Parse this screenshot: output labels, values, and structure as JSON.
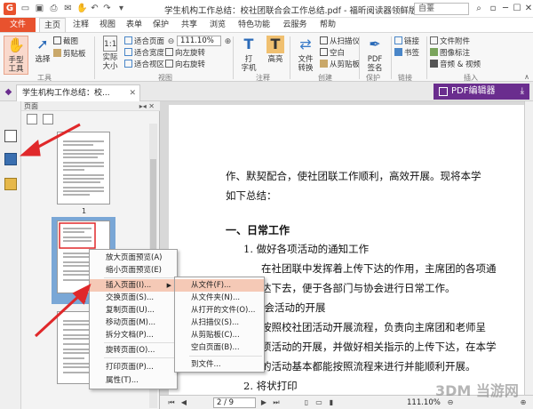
{
  "titlebar": {
    "title": "学生机构工作总结：校社团联合会工作总结.pdf - 福昕阅读器领鲜版",
    "search": "自薹"
  },
  "menubar": {
    "file": "文件",
    "tabs": [
      "主页",
      "注释",
      "视图",
      "表单",
      "保护",
      "共享",
      "浏览",
      "特色功能",
      "云服务",
      "帮助"
    ]
  },
  "ribbon": {
    "hand_tool": "手型\n工具",
    "select": "选择",
    "screenshot": "截图",
    "clipboard": "剪贴板",
    "group_tools": "工具",
    "actual_size": "实际\n大小",
    "fit_page": "适合页面",
    "fit_width": "适合宽度",
    "fit_visible": "适合视区",
    "zoom": "111.10%",
    "rotate_left": "向左旋转",
    "rotate_right": "向右旋转",
    "group_view": "视图",
    "typewriter": "打\n字机",
    "highlight": "高亮",
    "group_comment": "注释",
    "file_convert": "文件\n转换",
    "from_scanner": "从扫描仪",
    "blank": "空白",
    "from_clipboard": "从剪贴板",
    "group_create": "创建",
    "pdf_sign": "PDF\n签名",
    "group_protect": "保护",
    "link": "链接",
    "bookmark": "书签",
    "group_link": "链接",
    "file_attach": "文件附件",
    "image_anno": "图像标注",
    "audio_video": "音频 & 视频",
    "group_insert": "插入"
  },
  "docbar": {
    "doc_tab": "学生机构工作总结：校...",
    "pdf_editor": "PDF编辑器"
  },
  "panel": {
    "title": "页面",
    "page1": "1",
    "page2": "2"
  },
  "document": {
    "lines": [
      "作、默契配合，使社团联工作顺利，高效开展。现将本学",
      "如下总结：",
      "一、日常工作",
      "1. 做好各项活动的通知工作",
      "在社团联中发挥着上传下达的作用，主席团的各项通",
      "达下去，便于各部门与协会进行日常工作。",
      "协会活动的开展",
      "按照校社团活动开展流程，负责向主席团和老师呈",
      "项活动的开展，并做好相关指示的上传下达，在本学",
      "的活动基本都能按照流程来进行并能顺利开展。",
      "2. 将状打印"
    ]
  },
  "context_menu": {
    "items": [
      "放大页面预览(A)",
      "缩小页面预览(E)",
      "插入页面(I)...",
      "交换页面(S)...",
      "复制页面(U)...",
      "移动页面(M)...",
      "拆分文档(P)...",
      "旋转页面(O)...",
      "打印页面(P)...",
      "属性(T)..."
    ]
  },
  "submenu": {
    "items": [
      "从文件(F)...",
      "从文件夹(N)...",
      "从打开的文件(O)...",
      "从扫描仪(S)...",
      "从剪贴板(C)...",
      "空白页面(B)...",
      "到文件..."
    ]
  },
  "statusbar": {
    "page": "2 / 9",
    "zoom": "111.10%"
  },
  "watermark": "3DM 当游网",
  "colors": {
    "accent": "#e8522e",
    "pdf_editor": "#6a2d8e",
    "annotation": "#e0282a",
    "selection": "#7aa7d6",
    "menu_highlight": "#f5c9b6"
  }
}
